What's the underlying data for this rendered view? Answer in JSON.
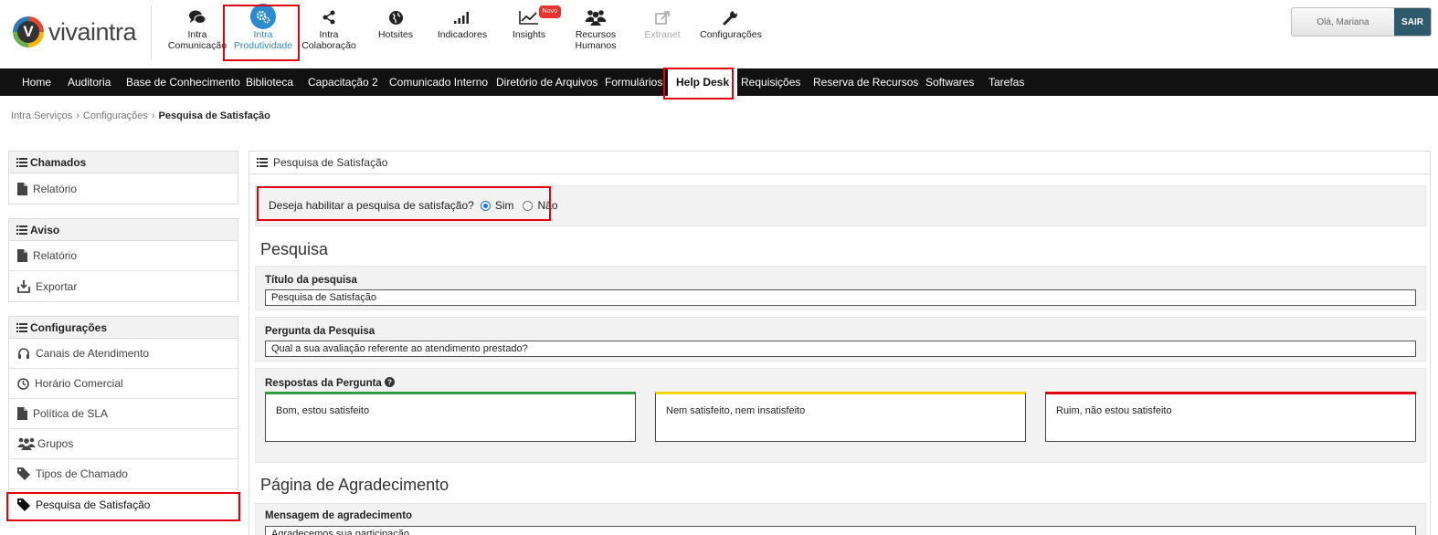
{
  "brand": {
    "name": "vivaintra",
    "mark": "V"
  },
  "modules": [
    {
      "id": "comunicacao",
      "label_line1": "Intra",
      "label_line2": "Comunicação",
      "icon": "chat-bubbles-icon"
    },
    {
      "id": "produtividade",
      "label_line1": "Intra",
      "label_line2": "Produtividade",
      "icon": "gears-icon",
      "active": true
    },
    {
      "id": "colaboracao",
      "label_line1": "Intra",
      "label_line2": "Colaboração",
      "icon": "share-icon"
    },
    {
      "id": "hotsites",
      "label_line1": "Hotsites",
      "label_line2": "",
      "icon": "globe-icon"
    },
    {
      "id": "indicadores",
      "label_line1": "Indicadores",
      "label_line2": "",
      "icon": "signal-bars-icon"
    },
    {
      "id": "insights",
      "label_line1": "Insights",
      "label_line2": "",
      "icon": "line-chart-icon",
      "badge": "Novo"
    },
    {
      "id": "rh",
      "label_line1": "Recursos",
      "label_line2": "Humanos",
      "icon": "people-group-icon"
    },
    {
      "id": "extranet",
      "label_line1": "Extranet",
      "label_line2": "",
      "icon": "external-link-icon",
      "disabled": true
    },
    {
      "id": "config",
      "label_line1": "Configurações",
      "label_line2": "",
      "icon": "wrench-icon"
    }
  ],
  "user": {
    "greeting": "Olá, Mariana",
    "logout": "SAIR"
  },
  "nav": [
    "Home",
    "Auditoria",
    "Base de Conhecimento",
    "Biblioteca",
    "Capacitação 2",
    "Comunicado Interno",
    "Diretório de Arquivos",
    "Formulários",
    "Help Desk",
    "Requisições",
    "Reserva de Recursos",
    "Softwares",
    "Tarefas"
  ],
  "nav_active": "Help Desk",
  "breadcrumb": {
    "item1": "Intra Serviços",
    "item2": "Configurações",
    "current": "Pesquisa de Satisfação"
  },
  "sidebar": {
    "chamados": {
      "title": "Chamados",
      "items": [
        "Relatório"
      ]
    },
    "aviso": {
      "title": "Aviso",
      "items": [
        "Relatório",
        "Exportar"
      ]
    },
    "configuracoes": {
      "title": "Configurações",
      "items": [
        "Canais de Atendimento",
        "Horário Comercial",
        "Política de SLA",
        "Grupos",
        "Tipos de Chamado",
        "Pesquisa de Satisfação"
      ]
    }
  },
  "main": {
    "header": "Pesquisa de Satisfação",
    "enable_question": "Deseja habilitar a pesquisa de satisfação?",
    "option_yes": "Sim",
    "option_no": "Não",
    "enabled": "Sim",
    "section_pesquisa": "Pesquisa",
    "titulo_label": "Título da pesquisa",
    "titulo_value": "Pesquisa de Satisfação",
    "pergunta_label": "Pergunta da Pesquisa",
    "pergunta_value": "Qual a sua avaliação referente ao atendimento prestado?",
    "respostas_label": "Respostas da Pergunta",
    "respostas": [
      {
        "text": "Bom, estou satisfeito",
        "color": "#2e9e3e"
      },
      {
        "text": "Nem satisfeito, nem insatisfeito",
        "color": "#f2d600"
      },
      {
        "text": "Ruim, não estou satisfeito",
        "color": "#e3000f"
      }
    ],
    "section_agradecimento": "Página de Agradecimento",
    "mensagem_label": "Mensagem de agradecimento",
    "mensagem_value": "Agradecemos sua participação"
  },
  "colors": {
    "accent": "#2a8bd0",
    "highlight": "#e3000f",
    "navbar": "#111111",
    "logout": "#2f5a6b"
  }
}
